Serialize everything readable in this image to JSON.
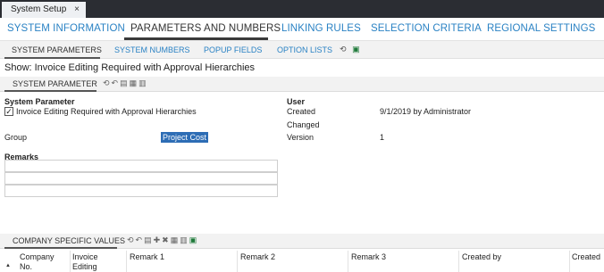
{
  "window_tab": {
    "title": "System Setup",
    "close": "×"
  },
  "mainnav": {
    "items": [
      "SYSTEM INFORMATION",
      "PARAMETERS AND NUMBERS",
      "LINKING RULES",
      "SELECTION CRITERIA",
      "REGIONAL SETTINGS"
    ],
    "active_index": 1
  },
  "subnav": {
    "items": [
      "SYSTEM PARAMETERS",
      "SYSTEM NUMBERS",
      "POPUP FIELDS",
      "OPTION LISTS"
    ],
    "active_index": 0,
    "icons": [
      "refresh-icon",
      "excel-icon"
    ]
  },
  "show": {
    "text": "Show: Invoice Editing Required with Approval Hierarchies"
  },
  "system_parameter_section": {
    "title": "SYSTEM PARAMETER",
    "icons": [
      "refresh-icon",
      "undo-icon",
      "save-icon",
      "print-icon",
      "print-preview-icon"
    ]
  },
  "form": {
    "system_parameter_label": "System Parameter",
    "checkbox_label": "Invoice Editing Required with Approval Hierarchies",
    "checkbox_checked": true,
    "group_label": "Group",
    "group_value": "Project Cost",
    "remarks_label": "Remarks",
    "user_label": "User",
    "created_label": "Created",
    "created_value": "9/1/2019 by Administrator",
    "changed_label": "Changed",
    "version_label": "Version",
    "version_value": "1"
  },
  "company_section": {
    "title": "COMPANY SPECIFIC VALUES",
    "icons": [
      "refresh-icon",
      "undo-icon",
      "save-icon",
      "add-row-icon",
      "delete-row-icon",
      "print-icon",
      "print-preview-icon",
      "excel-icon"
    ]
  },
  "table": {
    "columns": [
      {
        "line1": "Company",
        "line2": "No."
      },
      {
        "line1": "Invoice",
        "line2": "Editing"
      },
      {
        "line1": "Remark 1",
        "line2": ""
      },
      {
        "line1": "Remark 2",
        "line2": ""
      },
      {
        "line1": "Remark 3",
        "line2": ""
      },
      {
        "line1": "Created by",
        "line2": ""
      },
      {
        "line1": "Created",
        "line2": ""
      }
    ]
  }
}
